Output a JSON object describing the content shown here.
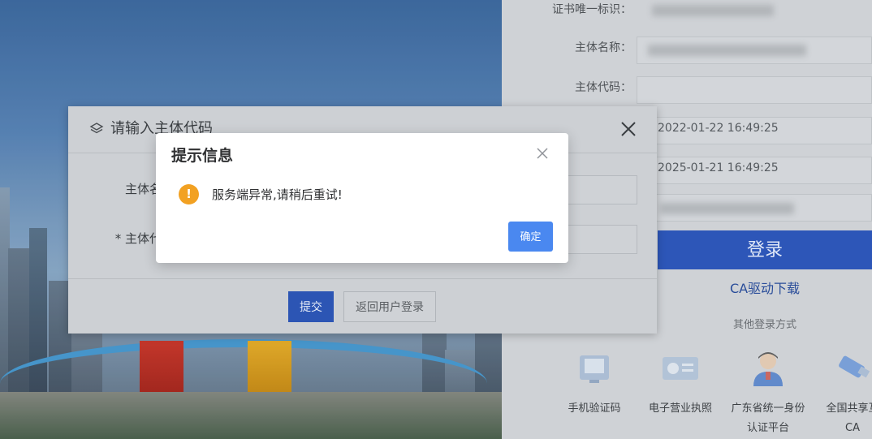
{
  "login_panel": {
    "fields": [
      {
        "label": "证书唯一标识：",
        "value": ""
      },
      {
        "label": "主体名称：",
        "value": ""
      },
      {
        "label": "主体代码：",
        "value": ""
      },
      {
        "label": "",
        "value": "2022-01-22 16:49:25"
      },
      {
        "label": "",
        "value": "2025-01-21 16:49:25"
      },
      {
        "label": "",
        "value": ""
      }
    ],
    "login_label": "登录",
    "ca_driver_link": "CA驱动下载",
    "other_methods_title": "其他登录方式",
    "alt_methods": [
      {
        "label": "手机验证码",
        "icon": "phone-verify-icon"
      },
      {
        "label": "电子营业执照",
        "icon": "business-license-icon"
      },
      {
        "label": "广东省统一身份\n认证平台",
        "line1": "广东省统一身份",
        "line2": "认证平台",
        "icon": "identity-person-icon"
      },
      {
        "label": "全国共享互\nCA",
        "line1": "全国共享互",
        "line2": "CA",
        "icon": "usb-key-icon"
      }
    ]
  },
  "entity_modal": {
    "title": "请输入主体代码",
    "fields": [
      {
        "label": "主体名",
        "value": ""
      },
      {
        "label": "* 主体代",
        "value": ""
      }
    ],
    "submit_label": "提交",
    "back_label": "返回用户登录"
  },
  "alert": {
    "title": "提示信息",
    "message": "服务端异常,请稍后重试!",
    "ok_label": "确定",
    "accent": "#4a88f0",
    "warn_color": "#f2a122"
  }
}
